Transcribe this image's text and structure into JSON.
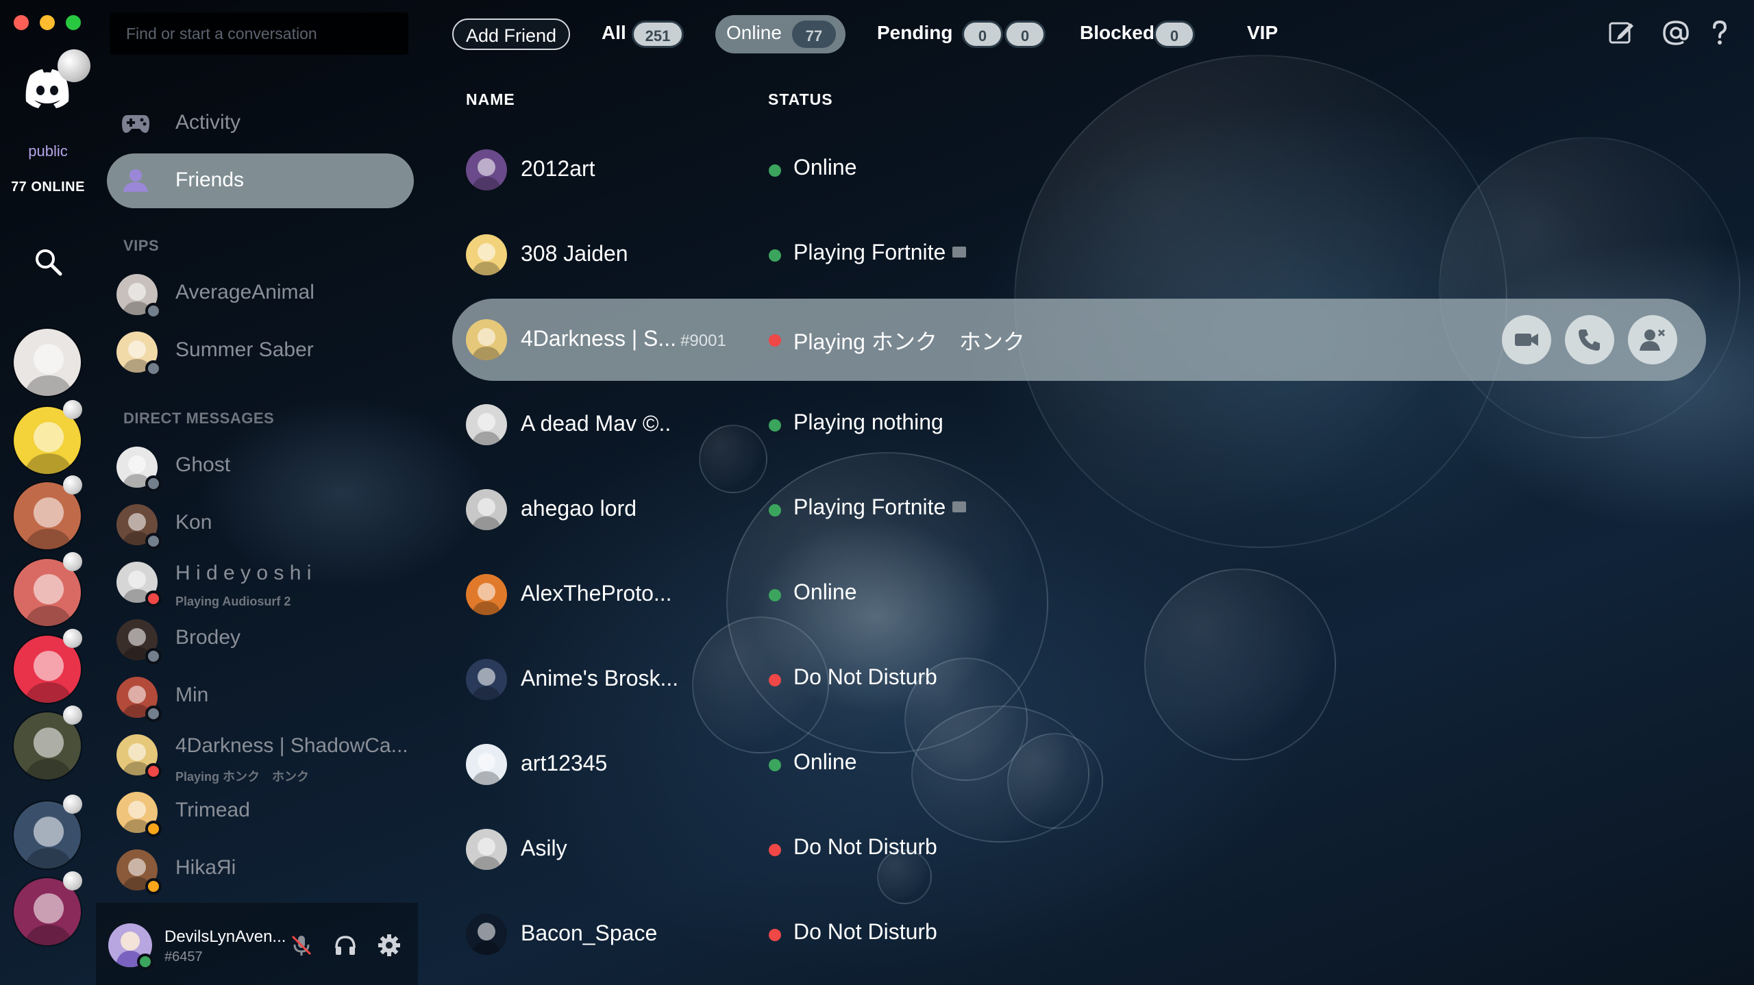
{
  "window": {
    "controls": [
      "close",
      "minimize",
      "maximize"
    ]
  },
  "rail": {
    "home_label": "public",
    "online_count": "77 ONLINE",
    "servers": [
      {
        "name": "server-1",
        "color": "#e9e6e4"
      },
      {
        "name": "server-2",
        "color": "#f3d23a"
      },
      {
        "name": "server-3",
        "color": "#c06a4a"
      },
      {
        "name": "server-4",
        "color": "#d96a63"
      },
      {
        "name": "server-5",
        "color": "#e8334a"
      },
      {
        "name": "server-6",
        "color": "#4a4f3a"
      },
      {
        "name": "server-7",
        "color": "#3a4f6a"
      },
      {
        "name": "server-8",
        "color": "#8a2a5a"
      }
    ]
  },
  "sidebar": {
    "search_placeholder": "Find or start a conversation",
    "nav": [
      {
        "label": "Activity",
        "icon": "gamepad-icon"
      },
      {
        "label": "Friends",
        "icon": "friends-icon",
        "active": true
      }
    ],
    "vips_label": "VIPS",
    "vips": [
      {
        "name": "AverageAnimal",
        "status": "offline",
        "color": "#c8c0bc"
      },
      {
        "name": "Summer Saber",
        "status": "offline",
        "color": "#f1d9a8"
      }
    ],
    "dm_label": "DIRECT MESSAGES",
    "dms": [
      {
        "name": "Ghost",
        "sub": "",
        "status": "offline",
        "color": "#e8e8e8"
      },
      {
        "name": "Kon",
        "sub": "",
        "status": "offline",
        "color": "#6a4a3a"
      },
      {
        "name": "H i d e y o s h i",
        "sub": "Playing Audiosurf 2",
        "status": "dnd",
        "color": "#d6d6d6"
      },
      {
        "name": "Brodey",
        "sub": "",
        "status": "offline",
        "color": "#3a2e2a"
      },
      {
        "name": "Min",
        "sub": "",
        "status": "offline",
        "color": "#b34a3a"
      },
      {
        "name": "4Darkness | ShadowCa...",
        "sub": "Playing ホンク　ホンク",
        "status": "dnd",
        "color": "#e6c87a"
      },
      {
        "name": "Trimead",
        "sub": "",
        "status": "idle",
        "color": "#f0c47a"
      },
      {
        "name": "HikaЯi",
        "sub": "",
        "status": "idle",
        "color": "#8a5a3a"
      }
    ],
    "user": {
      "name": "DevilsLynAven...",
      "tag": "#6457",
      "color": "#b8a6e0"
    }
  },
  "header": {
    "add_friend": "Add Friend",
    "tabs": [
      {
        "label": "All",
        "count": "251"
      },
      {
        "label": "Online",
        "count": "77",
        "active": true
      },
      {
        "label": "Pending",
        "count": "0",
        "count2": "0"
      },
      {
        "label": "Blocked",
        "count": "0"
      },
      {
        "label": "VIP"
      }
    ],
    "icons": [
      "new-group-dm-icon",
      "mention-icon",
      "help-icon"
    ]
  },
  "table": {
    "col_name": "NAME",
    "col_status": "STATUS",
    "rows": [
      {
        "name": "2012art",
        "tag": "",
        "status": "Online",
        "state": "online",
        "rich": false,
        "color": "#6a4a8a"
      },
      {
        "name": "308 Jaiden",
        "tag": "",
        "status": "Playing Fortnite",
        "state": "online",
        "rich": true,
        "color": "#f2d27a"
      },
      {
        "name": "4Darkness | S...",
        "tag": "#9001",
        "status": "Playing ホンク　ホンク",
        "state": "dnd",
        "rich": false,
        "color": "#e6c87a",
        "highlight": true
      },
      {
        "name": "A dead Mav ©..",
        "tag": "",
        "status": "Playing nothing",
        "state": "online",
        "rich": false,
        "color": "#d8d8d8"
      },
      {
        "name": "ahegao lord",
        "tag": "",
        "status": "Playing Fortnite",
        "state": "online",
        "rich": true,
        "color": "#c8c8c8"
      },
      {
        "name": "AlexTheProto...",
        "tag": "",
        "status": "Online",
        "state": "online",
        "rich": false,
        "color": "#e07a2a"
      },
      {
        "name": "Anime's Brosk...",
        "tag": "",
        "status": "Do Not Disturb",
        "state": "dnd",
        "rich": false,
        "color": "#2a3a5a"
      },
      {
        "name": "art12345",
        "tag": "",
        "status": "Online",
        "state": "online",
        "rich": false,
        "color": "#e8eef4"
      },
      {
        "name": "Asily",
        "tag": "",
        "status": "Do Not Disturb",
        "state": "dnd",
        "rich": false,
        "color": "#cfcfcf"
      },
      {
        "name": "Bacon_Space",
        "tag": "",
        "status": "Do Not Disturb",
        "state": "dnd",
        "rich": false,
        "color": "#0e1a2a"
      }
    ],
    "row_actions": [
      "video-call-icon",
      "voice-call-icon",
      "remove-friend-icon"
    ]
  },
  "colors": {
    "online": "#3ba55d",
    "dnd": "#f04747",
    "idle": "#faa61a",
    "offline": "#747f8d",
    "accent": "#b7a4e8"
  }
}
